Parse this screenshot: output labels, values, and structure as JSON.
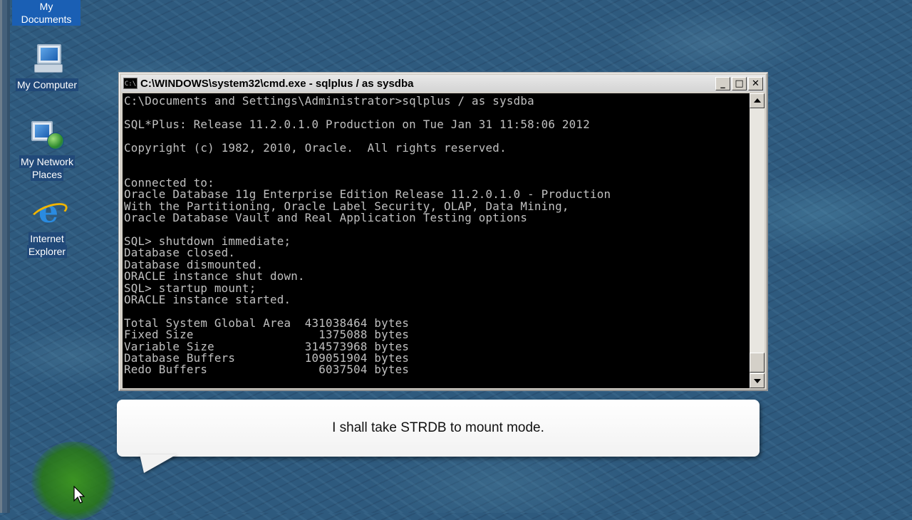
{
  "desktop": {
    "icons": [
      {
        "label": "My Documents"
      },
      {
        "label": "My Computer"
      },
      {
        "label_line1": "My Network",
        "label_line2": "Places"
      },
      {
        "label_line1": "Internet",
        "label_line2": "Explorer"
      }
    ]
  },
  "cmd_window": {
    "title": "C:\\WINDOWS\\system32\\cmd.exe - sqlplus  / as sysdba",
    "icon_text": "C:\\",
    "buttons": {
      "minimize": "_",
      "maximize": "□",
      "close": "✕"
    },
    "console_lines": [
      "C:\\Documents and Settings\\Administrator>sqlplus / as sysdba",
      "",
      "SQL*Plus: Release 11.2.0.1.0 Production on Tue Jan 31 11:58:06 2012",
      "",
      "Copyright (c) 1982, 2010, Oracle.  All rights reserved.",
      "",
      "",
      "Connected to:",
      "Oracle Database 11g Enterprise Edition Release 11.2.0.1.0 - Production",
      "With the Partitioning, Oracle Label Security, OLAP, Data Mining,",
      "Oracle Database Vault and Real Application Testing options",
      "",
      "SQL> shutdown immediate;",
      "Database closed.",
      "Database dismounted.",
      "ORACLE instance shut down.",
      "SQL> startup mount;",
      "ORACLE instance started.",
      "",
      "Total System Global Area  431038464 bytes",
      "Fixed Size                  1375088 bytes",
      "Variable Size             314573968 bytes",
      "Database Buffers          109051904 bytes",
      "Redo Buffers                6037504 bytes"
    ]
  },
  "callout": {
    "text": "I shall take STRDB to mount mode."
  },
  "colors": {
    "console_bg": "#000000",
    "console_fg": "#c0c0c0",
    "desktop_bg": "#2e5a7e",
    "selection": "#1a5fb4"
  }
}
